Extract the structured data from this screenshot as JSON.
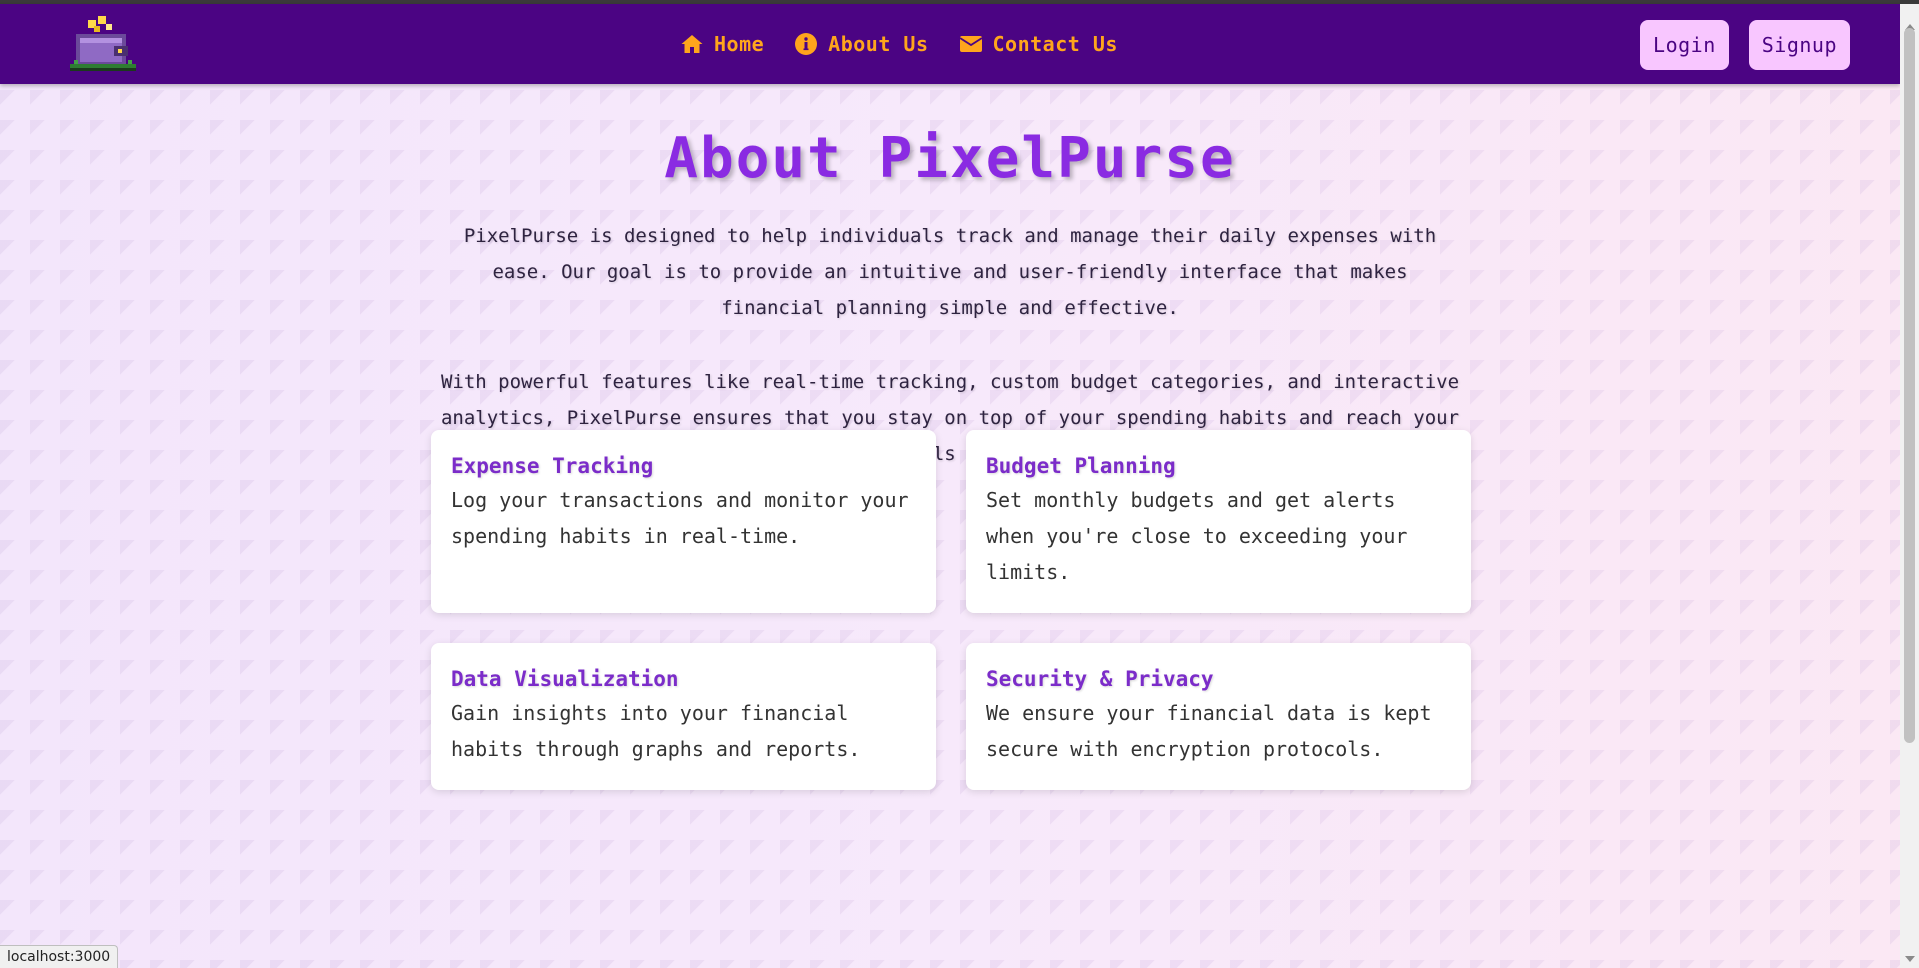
{
  "nav": {
    "links": [
      {
        "label": "Home",
        "icon": "home-icon"
      },
      {
        "label": "About Us",
        "icon": "info-icon"
      },
      {
        "label": "Contact Us",
        "icon": "envelope-icon"
      }
    ],
    "login_label": "Login",
    "signup_label": "Signup"
  },
  "page": {
    "title": "About PixelPurse",
    "intro1": "PixelPurse is designed to help individuals track and manage their daily expenses with ease. Our goal is to provide an intuitive and user-friendly interface that makes financial planning simple and effective.",
    "intro2": "With powerful features like real-time tracking, custom budget categories, and interactive analytics, PixelPurse ensures that you stay on top of your spending habits and reach your financial goals effortlessly."
  },
  "features": [
    {
      "title": "Expense Tracking",
      "desc": "Log your transactions and monitor your spending habits in real-time."
    },
    {
      "title": "Budget Planning",
      "desc": "Set monthly budgets and get alerts when you're close to exceeding your limits."
    },
    {
      "title": "Data Visualization",
      "desc": "Gain insights into your financial habits through graphs and reports."
    },
    {
      "title": "Security & Privacy",
      "desc": "We ensure your financial data is kept secure with encryption protocols."
    }
  ],
  "status_bar": {
    "url": "localhost:3000"
  },
  "colors": {
    "navbar": "#4b0483",
    "nav_link": "#ffa51c",
    "auth_button": "#f8c6ff",
    "title": "#8a2be2",
    "card_title": "#7b2cc9"
  }
}
